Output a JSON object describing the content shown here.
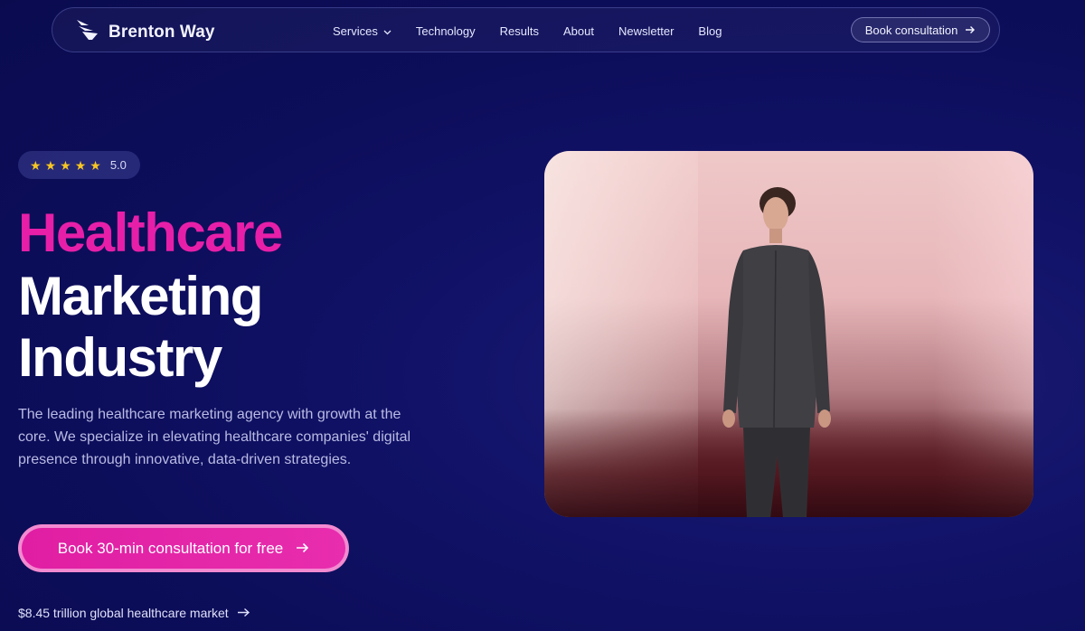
{
  "nav": {
    "brand": "Brenton Way",
    "links": [
      {
        "label": "Services",
        "has_dropdown": true
      },
      {
        "label": "Technology"
      },
      {
        "label": "Results"
      },
      {
        "label": "About"
      },
      {
        "label": "Newsletter"
      },
      {
        "label": "Blog"
      }
    ],
    "cta": "Book consultation"
  },
  "hero": {
    "rating": {
      "stars": 5,
      "value": "5.0"
    },
    "title_line1": "Healthcare",
    "title_line2": "Marketing",
    "title_line3": "Industry",
    "description": "The leading healthcare marketing agency with growth at the core. We specialize in elevating healthcare companies' digital presence through innovative, data-driven strategies.",
    "cta": "Book 30-min consultation for free",
    "market_link": "$8.45 trillion global healthcare market"
  },
  "colors": {
    "accent": "#e71fa8",
    "background": "#0f1060",
    "star": "#f6c623"
  },
  "icons": {
    "logo": "wing-logo-icon",
    "dropdown": "chevron-down-icon",
    "arrow": "arrow-right-icon",
    "star": "star-icon"
  }
}
